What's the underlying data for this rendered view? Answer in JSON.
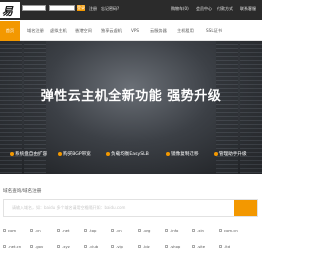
{
  "topbar": {
    "login_button": "登录",
    "register": "注册",
    "forgot_password": "忘记密码?",
    "cart": "购物车(0)",
    "member_center": "会员中心",
    "pay_online": "付款方式",
    "service": "联系客服"
  },
  "logo": {
    "text": "易云"
  },
  "nav": {
    "items": [
      "首页",
      "域名注册",
      "虚拟主机",
      "香港空间",
      "独享云虚机",
      "VPS",
      "云服务器",
      "主机租用",
      "SSL证书"
    ]
  },
  "banner": {
    "title": "弹性云主机全新功能  强势升级",
    "features": [
      "系统盘自由扩容",
      "购买BGP带宽",
      "负载均衡EasySLB",
      "镜像复制迁移",
      "管理助手升级"
    ],
    "accent_color": "#f39800"
  },
  "domain": {
    "heading": "域名查询/域名注册",
    "search_hint": "请输入域名，如：baidu   多个域名请用空格隔开如：baidu.com",
    "tlds": [
      "com",
      ".cn",
      ".net",
      ".top",
      ".cn",
      ".org",
      ".info",
      ".xin",
      "com.cn",
      ".net.cn",
      ".gov",
      ".xyz",
      ".club",
      ".vip",
      ".biz",
      ".shop",
      ".site",
      ".ltd"
    ]
  }
}
